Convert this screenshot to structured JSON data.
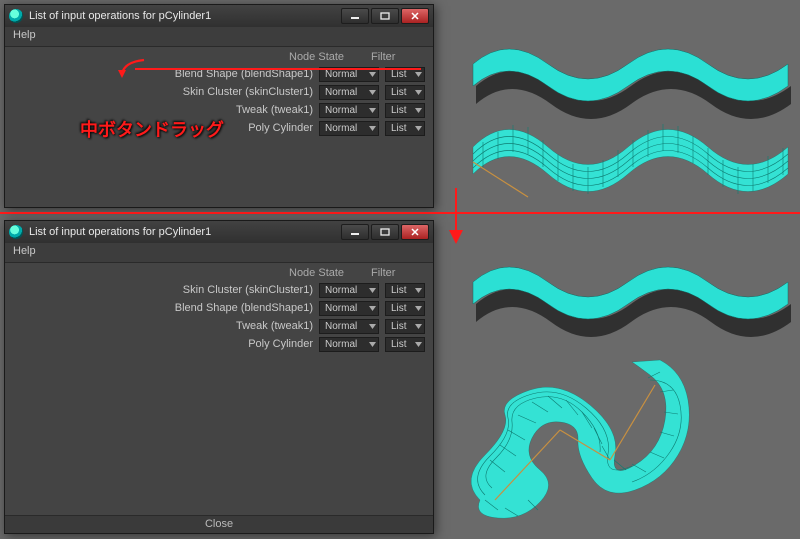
{
  "window_title": "List of input operations for pCylinder1",
  "menu": {
    "help": "Help"
  },
  "headers": {
    "node_state": "Node State",
    "filter": "Filter"
  },
  "top_panel": {
    "rows": [
      {
        "label": "Blend Shape (blendShape1)",
        "node_state": "Normal",
        "filter": "List"
      },
      {
        "label": "Skin Cluster (skinCluster1)",
        "node_state": "Normal",
        "filter": "List"
      },
      {
        "label": "Tweak (tweak1)",
        "node_state": "Normal",
        "filter": "List"
      },
      {
        "label": "Poly Cylinder",
        "node_state": "Normal",
        "filter": "List"
      }
    ]
  },
  "bottom_panel": {
    "rows": [
      {
        "label": "Skin Cluster (skinCluster1)",
        "node_state": "Normal",
        "filter": "List"
      },
      {
        "label": "Blend Shape (blendShape1)",
        "node_state": "Normal",
        "filter": "List"
      },
      {
        "label": "Tweak (tweak1)",
        "node_state": "Normal",
        "filter": "List"
      },
      {
        "label": "Poly Cylinder",
        "node_state": "Normal",
        "filter": "List"
      }
    ]
  },
  "close_label": "Close",
  "annotation": {
    "mmb_drag": "中ボタンドラッグ"
  },
  "colors": {
    "accent": "#ff1a1a",
    "cyan": "#2be0d4"
  }
}
